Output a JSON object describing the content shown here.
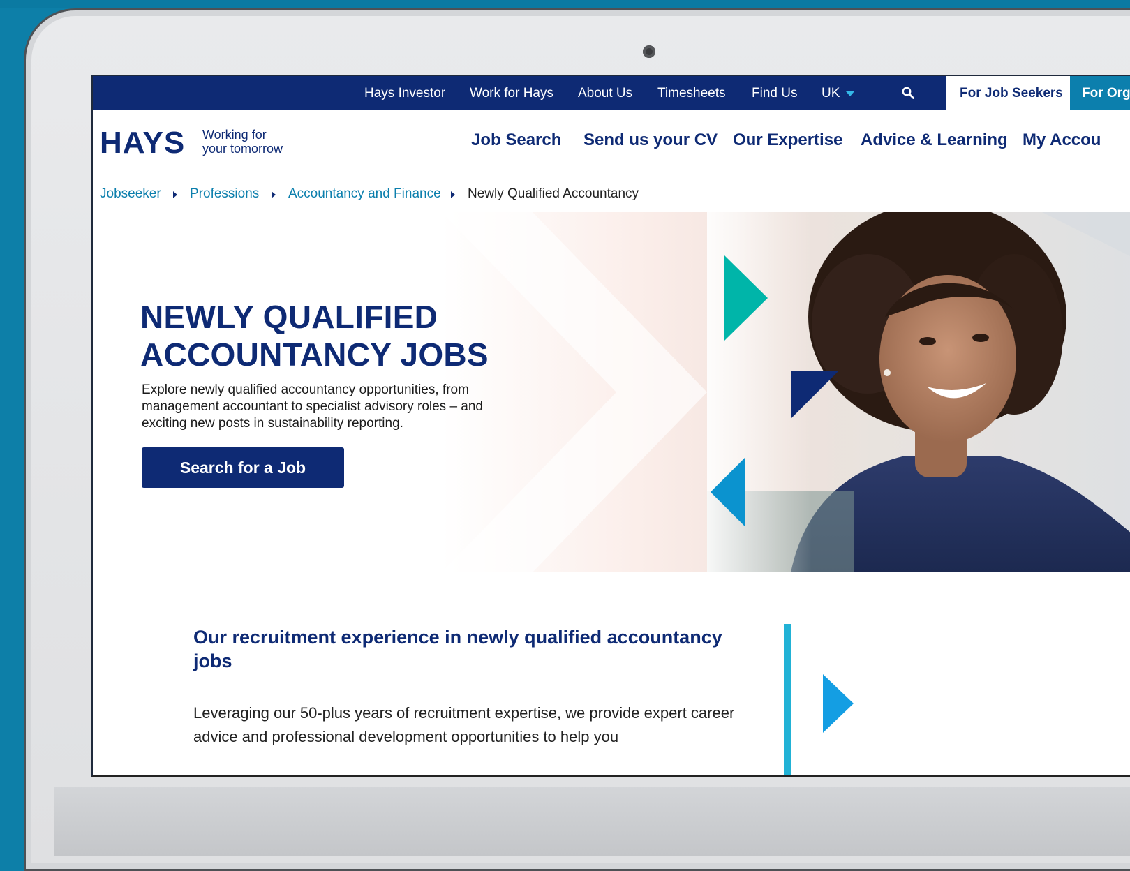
{
  "utility_bar": {
    "links": [
      "Hays Investor",
      "Work for Hays",
      "About Us",
      "Timesheets",
      "Find Us"
    ],
    "region": "UK",
    "for_job_seekers": "For Job Seekers",
    "for_organisations": "For Org"
  },
  "header": {
    "logo": "HAYS",
    "tagline_line1": "Working for",
    "tagline_line2": "your tomorrow",
    "nav": [
      "Job Search",
      "Send us your CV",
      "Our Expertise",
      "Advice & Learning",
      "My Accou"
    ]
  },
  "breadcrumb": [
    "Jobseeker",
    "Professions",
    "Accountancy and Finance",
    "Newly Qualified Accountancy"
  ],
  "hero": {
    "title_line1": "NEWLY QUALIFIED",
    "title_line2": "ACCOUNTANCY JOBS",
    "description": "Explore newly qualified accountancy opportunities, from management accountant to specialist advisory roles – and exciting new posts in sustainability reporting.",
    "cta": "Search for a Job"
  },
  "section": {
    "title": "Our recruitment experience in newly qualified accountancy jobs",
    "body": "Leveraging our 50-plus years of recruitment expertise, we provide expert career advice and professional development opportunities to help you"
  },
  "colors": {
    "brand_navy": "#0e2a74",
    "brand_teal": "#00b5a9",
    "link_blue": "#0c7fad",
    "accent_blue": "#149ee3"
  }
}
